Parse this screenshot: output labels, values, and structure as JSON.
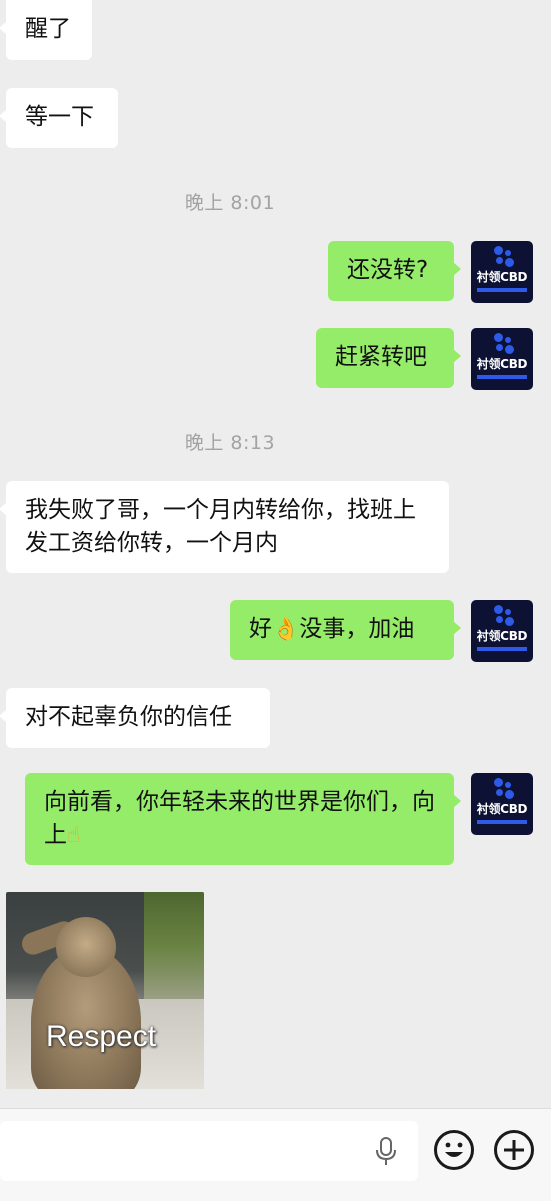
{
  "messages": {
    "m1": "醒了",
    "m2": "等一下",
    "ts1": "晚上 8:01",
    "m3": "还没转?",
    "m4": "赶紧转吧",
    "ts2": "晚上 8:13",
    "m5": "我失败了哥，一个月内转给你，找班上发工资给你转，一个月内",
    "m6_prefix": "好",
    "m6_emoji": "👌",
    "m6_suffix": "没事，加油",
    "m7": "对不起辜负你的信任",
    "m8_text": "向前看，你年轻未来的世界是你们，向上",
    "m8_emoji": "☝"
  },
  "avatar": {
    "logo_text": "衬领CBD",
    "bg_color": "#0d1133",
    "accent_color": "#2e5ae8"
  },
  "sticker": {
    "caption": "Respect"
  },
  "input_bar": {
    "mic": "mic-icon",
    "emoji": "emoji-icon",
    "add": "plus-icon"
  },
  "colors": {
    "background": "#ededed",
    "outgoing_bubble": "#95ec69",
    "incoming_bubble": "#ffffff",
    "timestamp": "#a3a3a3"
  }
}
